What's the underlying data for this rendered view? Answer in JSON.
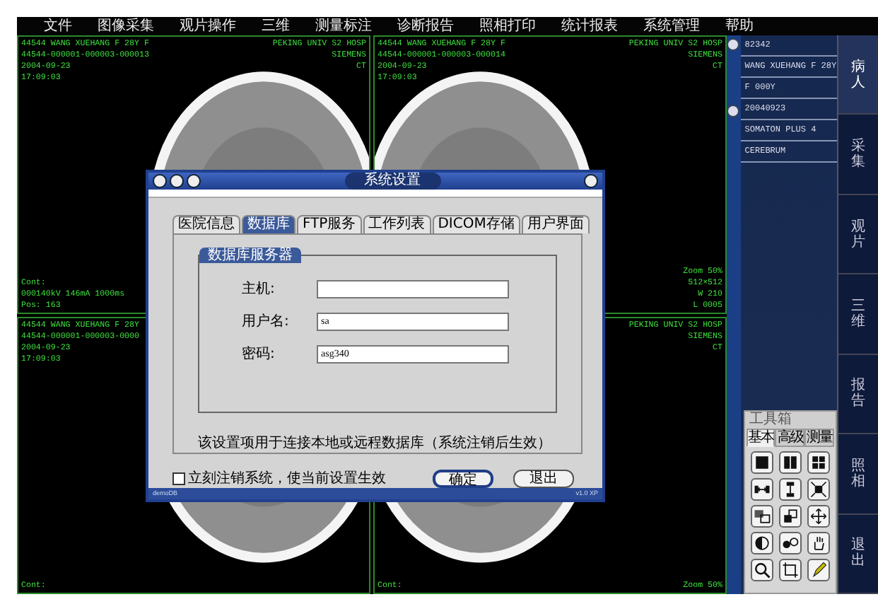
{
  "menu": [
    "文件",
    "图像采集",
    "观片操作",
    "三维",
    "测量标注",
    "诊断报告",
    "照相打印",
    "统计报表",
    "系统管理",
    "帮助"
  ],
  "viewports": [
    {
      "top_left": [
        "44544 WANG XUEHANG F 28Y F",
        "44544-000001-000003-000013",
        "2004-09-23",
        "17:09:03"
      ],
      "top_right": [
        "PEKING UNIV  S2 HOSP",
        "SIEMENS",
        "CT"
      ],
      "bottom_left": [
        "Cont:",
        "000140kV 146mA 1000ms",
        "Pos: 163"
      ]
    },
    {
      "top_left": [
        "44544 WANG XUEHANG F 28Y F",
        "44544-000001-000003-000014",
        "2004-09-23",
        "17:09:03"
      ],
      "top_right": [
        "PEKING UNIV  S2 HOSP",
        "SIEMENS",
        "CT"
      ],
      "bottom_right": [
        "Zoom 50%",
        "512×512",
        "W 210",
        "L 0005"
      ]
    },
    {
      "top_left": [
        "44544 WANG XUEHANG F 28Y",
        "44544-000001-000003-0000",
        "2004-09-23",
        "17:09:03"
      ],
      "bottom_left": [
        "Cont:"
      ]
    },
    {
      "top_right": [
        "PEKING UNIV  S2 HOSP",
        "SIEMENS",
        "CT"
      ],
      "bottom_left": [
        "Cont:"
      ],
      "bottom_right": [
        "Zoom 50%"
      ]
    }
  ],
  "patient_info": [
    "82342",
    "WANG XUEHANG F 28Y",
    "F 000Y",
    "20040923",
    "SOMATON PLUS 4",
    "CEREBRUM"
  ],
  "side_tabs": [
    {
      "label": "病人",
      "selected": true
    },
    {
      "label": "采集",
      "selected": false
    },
    {
      "label": "观片",
      "selected": false
    },
    {
      "label": "三维",
      "selected": false
    },
    {
      "label": "报告",
      "selected": false
    },
    {
      "label": "照相",
      "selected": false
    },
    {
      "label": "退出",
      "selected": false
    }
  ],
  "toolbox": {
    "title": "工具箱",
    "tabs": [
      {
        "label": "基本",
        "selected": true
      },
      {
        "label": "高级",
        "selected": false
      },
      {
        "label": "测量",
        "selected": false
      }
    ]
  },
  "dialog": {
    "title": "系统设置",
    "tabs": [
      {
        "label": "医院信息",
        "selected": false
      },
      {
        "label": "数据库",
        "selected": true
      },
      {
        "label": "FTP服务",
        "selected": false
      },
      {
        "label": "工作列表",
        "selected": false
      },
      {
        "label": "DICOM存储",
        "selected": false
      },
      {
        "label": "用户界面",
        "selected": false
      }
    ],
    "group_title": "数据库服务器",
    "fields": [
      {
        "label": "主机:"
      },
      {
        "label": "用户名:",
        "value": "sa"
      },
      {
        "label": "密码:",
        "value": "asg340"
      }
    ],
    "note": "该设置项用于连接本地或远程数据库（系统注销后生效）",
    "checkbox": {
      "label": "立刻注销系统，使当前设置生效",
      "checked": false
    },
    "buttons": [
      {
        "label": "确定",
        "kind": "default"
      },
      {
        "label": "退出",
        "kind": "normal"
      }
    ],
    "status_left": "demoDB",
    "status_right": "v1.0 XP"
  }
}
